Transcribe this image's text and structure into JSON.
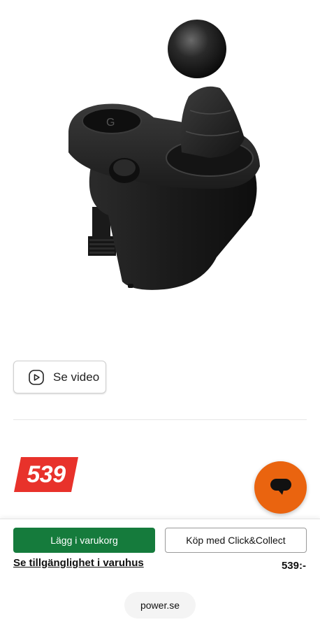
{
  "product": {
    "video_button_label": "Se video",
    "price_badge": "539",
    "price_small": "539:-"
  },
  "actions": {
    "add_to_cart_label": "Lägg i varukorg",
    "click_collect_label": "Köp med Click&Collect",
    "availability_link": "Se tillgänglighet i varuhus"
  },
  "browser": {
    "url": "power.se"
  },
  "colors": {
    "price_badge": "#e8322b",
    "add_to_cart": "#157b3c",
    "chat_button": "#ea640f"
  },
  "icons": {
    "video": "play-icon",
    "chat": "chat-icon"
  }
}
